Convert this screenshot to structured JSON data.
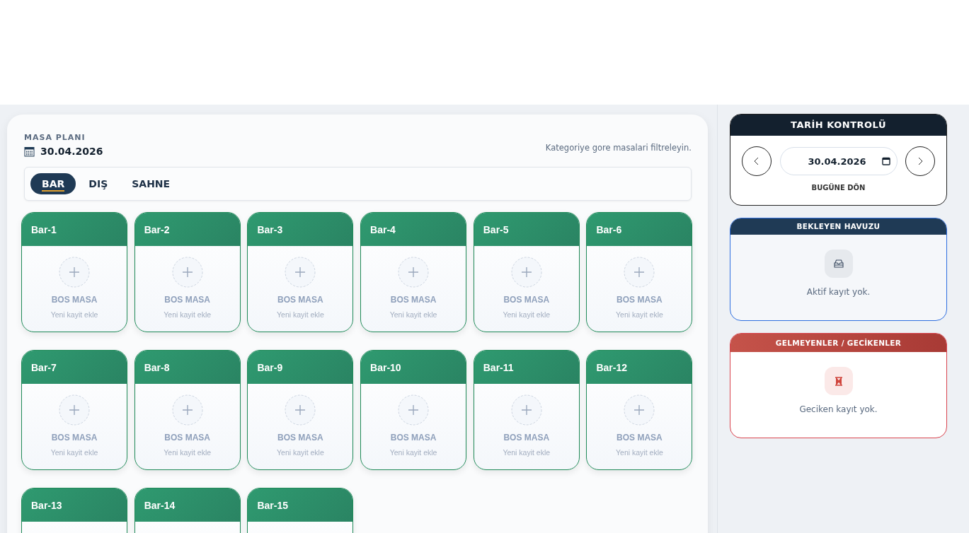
{
  "plan": {
    "title": "MASA PLANI",
    "date": "30.04.2026",
    "hint": "Kategoriye gore masalari filtreleyin."
  },
  "tabs": [
    {
      "label": "BAR",
      "selected": true
    },
    {
      "label": "DIŞ",
      "selected": false
    },
    {
      "label": "SAHNE",
      "selected": false
    }
  ],
  "tables": [
    {
      "name": "Bar-1",
      "status": "BOS MASA",
      "action": "Yeni kayit ekle"
    },
    {
      "name": "Bar-2",
      "status": "BOS MASA",
      "action": "Yeni kayit ekle"
    },
    {
      "name": "Bar-3",
      "status": "BOS MASA",
      "action": "Yeni kayit ekle"
    },
    {
      "name": "Bar-4",
      "status": "BOS MASA",
      "action": "Yeni kayit ekle"
    },
    {
      "name": "Bar-5",
      "status": "BOS MASA",
      "action": "Yeni kayit ekle"
    },
    {
      "name": "Bar-6",
      "status": "BOS MASA",
      "action": "Yeni kayit ekle"
    },
    {
      "name": "Bar-7",
      "status": "BOS MASA",
      "action": "Yeni kayit ekle"
    },
    {
      "name": "Bar-8",
      "status": "BOS MASA",
      "action": "Yeni kayit ekle"
    },
    {
      "name": "Bar-9",
      "status": "BOS MASA",
      "action": "Yeni kayit ekle"
    },
    {
      "name": "Bar-10",
      "status": "BOS MASA",
      "action": "Yeni kayit ekle"
    },
    {
      "name": "Bar-11",
      "status": "BOS MASA",
      "action": "Yeni kayit ekle"
    },
    {
      "name": "Bar-12",
      "status": "BOS MASA",
      "action": "Yeni kayit ekle"
    },
    {
      "name": "Bar-13"
    },
    {
      "name": "Bar-14"
    },
    {
      "name": "Bar-15"
    }
  ],
  "date_control": {
    "title": "TARİH KONTROLÜ",
    "date": "30.04.2026",
    "today": "BUGÜNE DÖN"
  },
  "panels": [
    {
      "kind": "pending",
      "title": "BEKLEYEN HAVUZU",
      "message": "Aktif kayıt yok."
    },
    {
      "kind": "late",
      "title": "GELMEYENLER / GECİKENLER",
      "message": "Geciken kayıt yok."
    }
  ]
}
